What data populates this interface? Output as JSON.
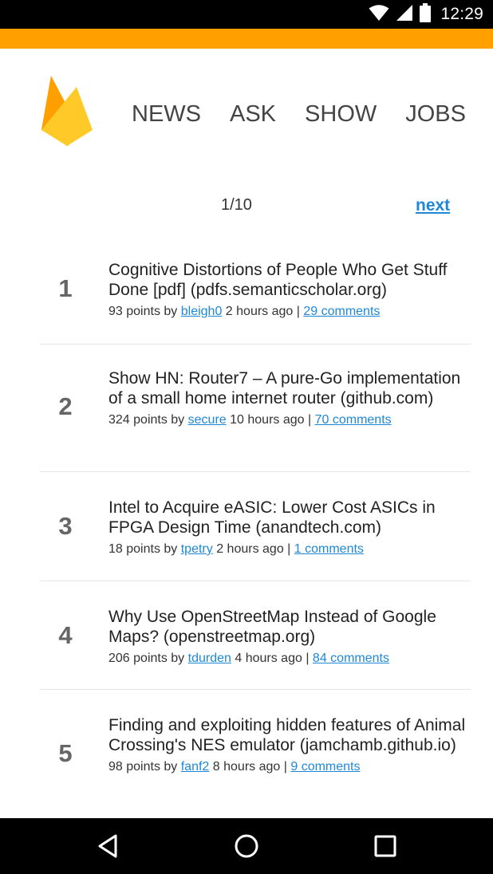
{
  "status_bar": {
    "time": "12:29",
    "icons": [
      "wifi-icon",
      "cell-signal-icon",
      "battery-icon"
    ]
  },
  "colors": {
    "accent": "#FFA000",
    "link": "#1E88D6",
    "status_bar": "#000000",
    "logo_dark": "#F57C00",
    "logo_mid": "#FFA000",
    "logo_light": "#FFCA28"
  },
  "header": {
    "logo": "firebase-logo",
    "nav": [
      "NEWS",
      "ASK",
      "SHOW",
      "JOBS"
    ]
  },
  "pager": {
    "page": "1/10",
    "next_label": "next"
  },
  "stories": [
    {
      "rank": "1",
      "title": "Cognitive Distortions of People Who Get Stuff Done [pdf] (pdfs.semanticscholar.org)",
      "points_text": "93 points by",
      "user": "bleigh0",
      "age_text": "2 hours ago |",
      "comments": "29 comments"
    },
    {
      "rank": "2",
      "title": "Show HN: Router7 – A pure-Go implementation of a small home internet router (github.com)",
      "points_text": "324 points by",
      "user": "secure",
      "age_text": "10 hours ago |",
      "comments": "70 comments"
    },
    {
      "rank": "3",
      "title": "Intel to Acquire eASIC: Lower Cost ASICs in FPGA Design Time (anandtech.com)",
      "points_text": "18 points by",
      "user": "tpetry",
      "age_text": "2 hours ago |",
      "comments": "1 comments"
    },
    {
      "rank": "4",
      "title": "Why Use OpenStreetMap Instead of Google Maps? (openstreetmap.org)",
      "points_text": "206 points by",
      "user": "tdurden",
      "age_text": "4 hours ago |",
      "comments": "84 comments"
    },
    {
      "rank": "5",
      "title": "Finding and exploiting hidden features of Animal Crossing's NES emulator (jamchamb.github.io)",
      "points_text": "98 points by",
      "user": "fanf2",
      "age_text": "8 hours ago |",
      "comments": "9 comments"
    }
  ],
  "system_nav": [
    "back-icon",
    "home-icon",
    "recents-icon"
  ]
}
